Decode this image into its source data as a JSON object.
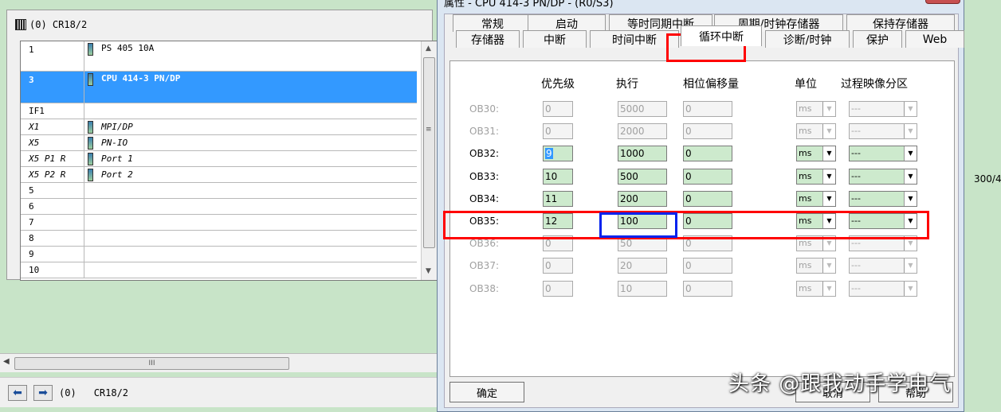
{
  "rack": {
    "title": "(0) CR18/2",
    "rows": [
      {
        "slot": "1",
        "module": "PS 405 10A",
        "icon": "module-icon",
        "italic": false,
        "selected": false
      },
      {
        "slot": "3",
        "module": "CPU 414-3 PN/DP",
        "icon": "module-icon",
        "italic": false,
        "selected": true
      },
      {
        "slot": "IF1",
        "module": "",
        "icon": "",
        "italic": false,
        "selected": false
      },
      {
        "slot": "X1",
        "module": "MPI/DP",
        "icon": "module-icon",
        "italic": true,
        "selected": false
      },
      {
        "slot": "X5",
        "module": "PN-IO",
        "icon": "module-icon",
        "italic": true,
        "selected": false
      },
      {
        "slot": "X5 P1 R",
        "module": "Port 1",
        "icon": "module-icon",
        "italic": true,
        "selected": false
      },
      {
        "slot": "X5 P2 R",
        "module": "Port 2",
        "icon": "module-icon",
        "italic": true,
        "selected": false
      },
      {
        "slot": "5",
        "module": "",
        "icon": "",
        "italic": false,
        "selected": false
      },
      {
        "slot": "6",
        "module": "",
        "icon": "",
        "italic": false,
        "selected": false
      },
      {
        "slot": "7",
        "module": "",
        "icon": "",
        "italic": false,
        "selected": false
      },
      {
        "slot": "8",
        "module": "",
        "icon": "",
        "italic": false,
        "selected": false
      },
      {
        "slot": "9",
        "module": "",
        "icon": "",
        "italic": false,
        "selected": false
      },
      {
        "slot": "10",
        "module": "",
        "icon": "",
        "italic": false,
        "selected": false
      }
    ]
  },
  "status": {
    "station": "(0)",
    "name": "CR18/2",
    "hscroll_grip": "III"
  },
  "side_label": "300/4",
  "dialog": {
    "title": "属性 - CPU 414-3 PN/DP - (R0/S3)",
    "close": "X",
    "tabs_row1": [
      "常规",
      "启动",
      "等时同期中断",
      "周期/时钟存储器",
      "保持存储器"
    ],
    "tabs_row2": [
      "存储器",
      "中断",
      "时间中断",
      "循环中断",
      "诊断/时钟",
      "保护",
      "Web"
    ],
    "active_tab": "循环中断",
    "columns": {
      "priority": "优先级",
      "execution": "执行",
      "phase_offset": "相位偏移量",
      "unit": "单位",
      "process_image": "过程映像分区"
    },
    "rows": [
      {
        "ob": "OB30:",
        "priority": "0",
        "execution": "5000",
        "offset": "0",
        "unit": "ms",
        "pi": "---",
        "enabled": false
      },
      {
        "ob": "OB31:",
        "priority": "0",
        "execution": "2000",
        "offset": "0",
        "unit": "ms",
        "pi": "---",
        "enabled": false
      },
      {
        "ob": "OB32:",
        "priority": "9",
        "execution": "1000",
        "offset": "0",
        "unit": "ms",
        "pi": "---",
        "enabled": true
      },
      {
        "ob": "OB33:",
        "priority": "10",
        "execution": "500",
        "offset": "0",
        "unit": "ms",
        "pi": "---",
        "enabled": true
      },
      {
        "ob": "OB34:",
        "priority": "11",
        "execution": "200",
        "offset": "0",
        "unit": "ms",
        "pi": "---",
        "enabled": true
      },
      {
        "ob": "OB35:",
        "priority": "12",
        "execution": "100",
        "offset": "0",
        "unit": "ms",
        "pi": "---",
        "enabled": true
      },
      {
        "ob": "OB36:",
        "priority": "0",
        "execution": "50",
        "offset": "0",
        "unit": "ms",
        "pi": "---",
        "enabled": false
      },
      {
        "ob": "OB37:",
        "priority": "0",
        "execution": "20",
        "offset": "0",
        "unit": "ms",
        "pi": "---",
        "enabled": false
      },
      {
        "ob": "OB38:",
        "priority": "0",
        "execution": "10",
        "offset": "0",
        "unit": "ms",
        "pi": "---",
        "enabled": false
      }
    ],
    "ok_button": "确定",
    "cancel_button": "取消",
    "help_button": "帮助"
  },
  "watermark": "头条 @跟我动手学电气",
  "colors": {
    "selection": "#3399ff",
    "annotation_red": "#ff0000",
    "annotation_blue": "#0022ee",
    "field_green": "#cdeacd"
  }
}
